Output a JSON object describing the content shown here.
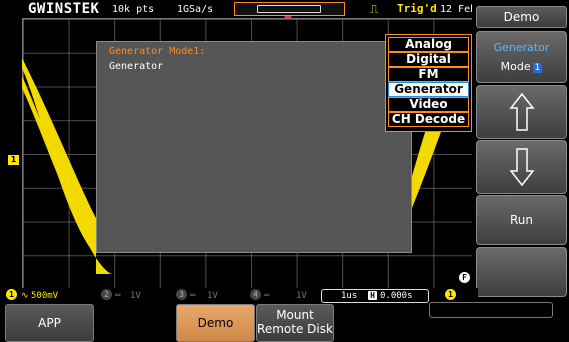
{
  "header": {
    "logo": "GWINSTEK",
    "record_length": "10k pts",
    "sample_rate": "1GSa/s",
    "trigger_status": "Trig'd",
    "date": "12 Feb"
  },
  "dialog": {
    "title": "Generator Mode1:",
    "body": "Generator"
  },
  "mode_menu": {
    "items": [
      "Analog",
      "Digital",
      "FM",
      "Generator",
      "Video",
      "CH Decode"
    ],
    "selected": "Generator"
  },
  "side_panel": {
    "title": "Demo",
    "mode_label_line1": "Generator",
    "mode_label_line2": "Mode",
    "mode_number": "1",
    "run_label": "Run"
  },
  "status_bar": {
    "ch1": {
      "label": "1",
      "scale": "500mV"
    },
    "ch2": {
      "label": "2",
      "scale": "1V"
    },
    "ch3": {
      "label": "3",
      "scale": "1V"
    },
    "ch4": {
      "label": "4",
      "scale": "1V"
    },
    "timebase": "1us",
    "horizontal_position": "0.000s",
    "f_label": "F"
  },
  "bottom_menu": {
    "app": "APP",
    "demo": "Demo",
    "mount_line1": "Mount",
    "mount_line2": "Remote Disk"
  },
  "colors": {
    "ch1": "#ffe600",
    "accent": "#ff8c1a",
    "selected_blue": "#2a8fd8"
  }
}
